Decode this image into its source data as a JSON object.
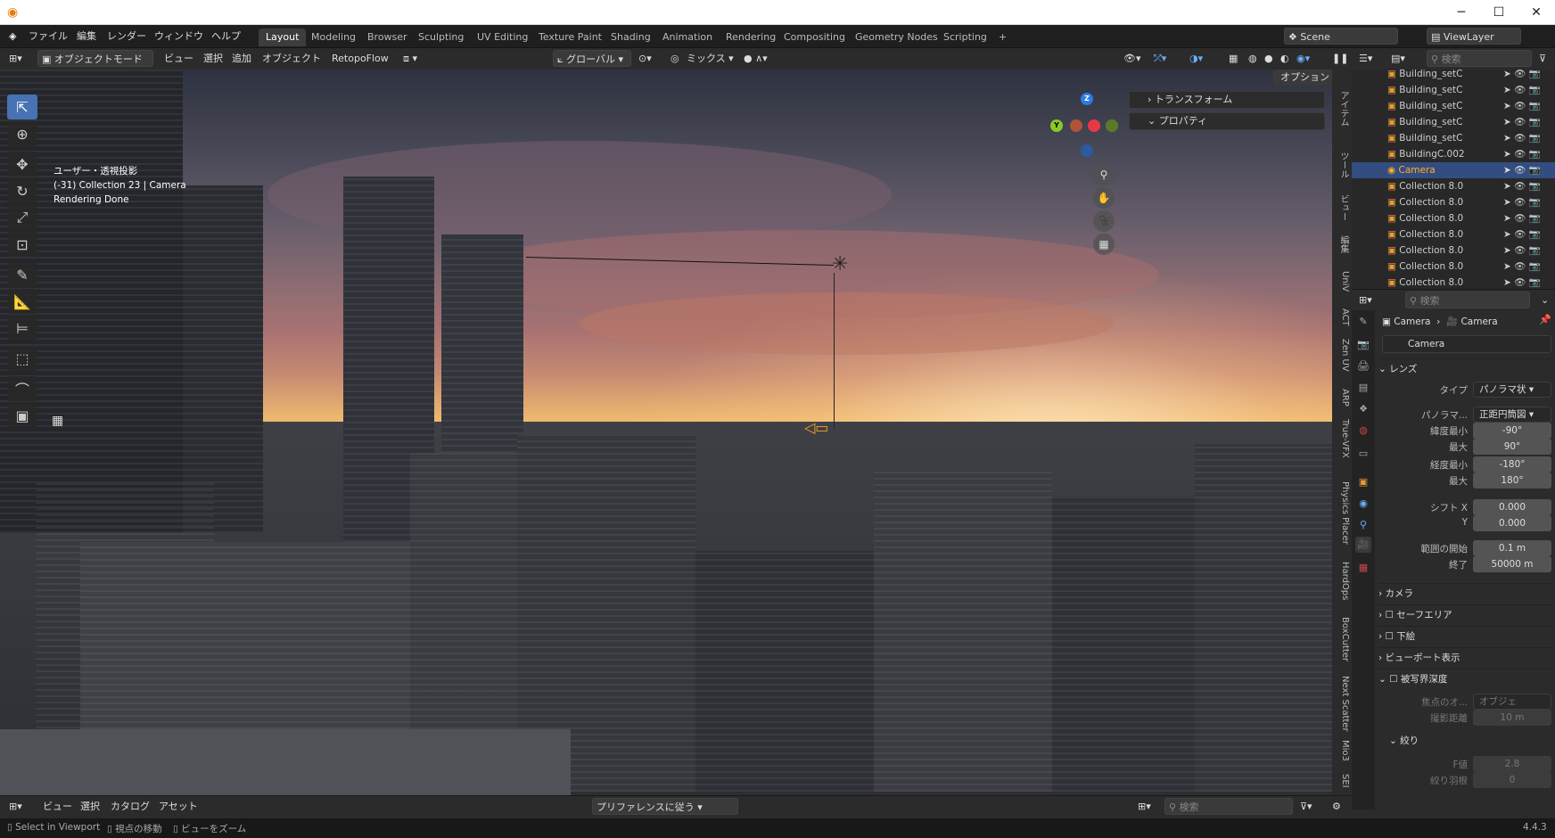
{
  "app": {
    "logo_icon": "blender-logo",
    "win_min": "─",
    "win_max": "☐",
    "win_close": "✕"
  },
  "menu": [
    "ファイル",
    "編集",
    "レンダー",
    "ウィンドウ",
    "ヘルプ"
  ],
  "workspaces": [
    "Layout",
    "Modeling",
    "Browser",
    "Sculpting",
    "UV Editing",
    "Texture Paint",
    "Shading",
    "Animation",
    "Rendering",
    "Compositing",
    "Geometry Nodes",
    "Scripting"
  ],
  "active_workspace": "Layout",
  "add_workspace": "+",
  "scene": {
    "label": "Scene",
    "viewlayer": "ViewLayer"
  },
  "header": {
    "mode": "オブジェクトモード",
    "view": "ビュー",
    "select": "選択",
    "add": "追加",
    "object": "オブジェクト",
    "addon": "RetopoFlow",
    "orientation": "グローバル",
    "pivot": "ミックス",
    "options": "オプション"
  },
  "viewport": {
    "line1": "ユーザー・透視投影",
    "line2": "(-31) Collection 23 | Camera",
    "line3": "Rendering Done"
  },
  "gizmo": {
    "z": "Z",
    "y": "Y",
    "x": "X"
  },
  "npanel": {
    "transform": "トランスフォーム",
    "properties": "プロパティ"
  },
  "side_tabs": [
    "アイテム",
    "ツール",
    "ビュー",
    "編集",
    "UniV",
    "ACT",
    "Zen UV",
    "ARP",
    "True-VFX",
    "Physics Placer",
    "HardOps",
    "BoxCutter",
    "Next Scatter",
    "Mio3",
    "SEI"
  ],
  "outliner": {
    "items": [
      "Building_setC",
      "Building_setC",
      "Building_setC",
      "Building_setC",
      "Building_setC",
      "BuildingC.002",
      "Camera",
      "Collection 8.0",
      "Collection 8.0",
      "Collection 8.0",
      "Collection 8.0",
      "Collection 8.0",
      "Collection 8.0",
      "Collection 8.0"
    ],
    "selected": 6,
    "search_placeholder": "検索"
  },
  "props": {
    "search_placeholder": "検索",
    "crumb_obj": "Camera",
    "crumb_data": "Camera",
    "datablock": "Camera",
    "lens_header": "レンズ",
    "type_label": "タイプ",
    "type_value": "パノラマ状",
    "pano_label": "パノラマ...",
    "pano_value": "正距円筒図",
    "lat_min_label": "緯度最小",
    "lat_min": "-90°",
    "lat_max_label": "最大",
    "lat_max": "90°",
    "lon_min_label": "経度最小",
    "lon_min": "-180°",
    "lon_max_label": "最大",
    "lon_max": "180°",
    "shift_x_label": "シフト X",
    "shift_x": "0.000",
    "shift_y_label": "Y",
    "shift_y": "0.000",
    "clip_start_label": "範囲の開始",
    "clip_start": "0.1 m",
    "clip_end_label": "終了",
    "clip_end": "50000 m",
    "sections": [
      "カメラ",
      "セーフエリア",
      "下絵",
      "ビューポート表示",
      "被写界深度"
    ],
    "focus_label": "焦点のオ...",
    "focus_value": "オブジェ",
    "focus_dist_label": "撮影距離",
    "focus_dist": "10 m",
    "aperture_header": "絞り",
    "fstop_label": "F値",
    "fstop": "2.8",
    "blades_label": "絞り羽根",
    "blades": "0"
  },
  "bottom": {
    "view": "ビュー",
    "select": "選択",
    "catalog": "カタログ",
    "asset": "アセット",
    "pref": "プリファレンスに従う",
    "search_placeholder": "検索"
  },
  "status": {
    "s1": "Select in Viewport",
    "s2": "視点の移動",
    "s3": "ビューをズーム",
    "version": "4.4.3"
  }
}
